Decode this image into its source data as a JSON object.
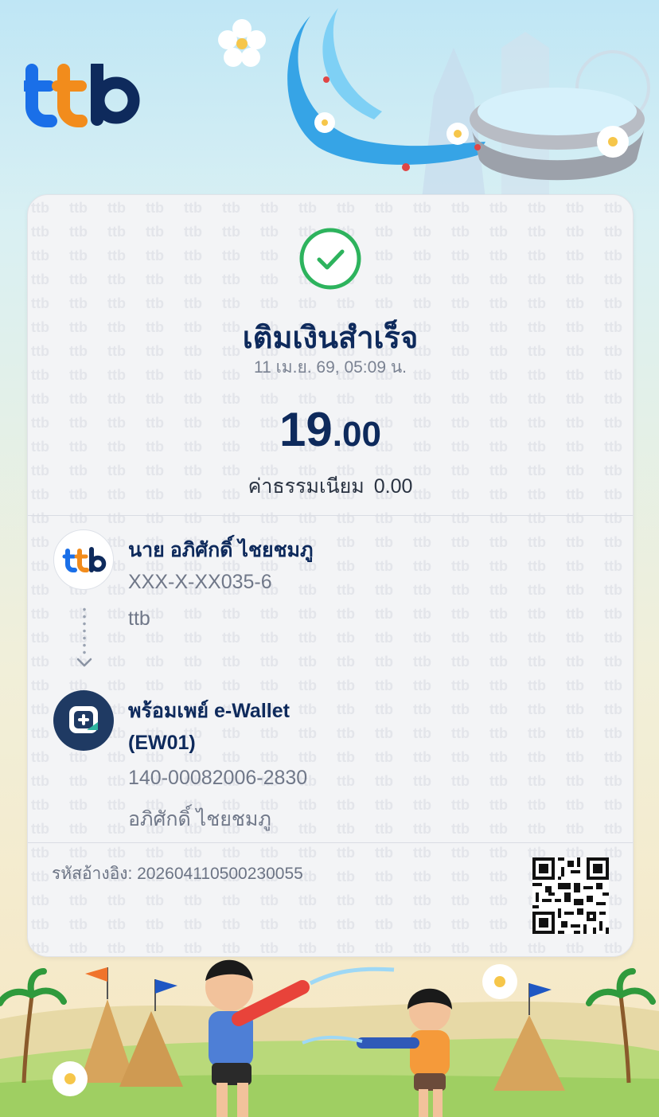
{
  "brand": {
    "name": "ttb",
    "colors": {
      "navy": "#0e2a5c",
      "blue": "#1a6fe8",
      "orange": "#f28c1c",
      "success": "#2db35d"
    }
  },
  "receipt": {
    "status_title": "เติมเงินสำเร็จ",
    "datetime": "11 เม.ย. 69, 05:09 น.",
    "amount_main": "19",
    "amount_decimal": ".00",
    "fee_label": "ค่าธรรมเนียม",
    "fee_value": "0.00"
  },
  "sender": {
    "name": "นาย อภิศักดิ์  ไชยชมภู",
    "account": "XXX-X-XX035-6",
    "bank": "ttb",
    "logo_text": "ttb"
  },
  "receiver": {
    "name": "พร้อมเพย์ e-Wallet",
    "code": "(EW01)",
    "account": "140-00082006-2830",
    "account_name": "อภิศักดิ์ ไชยชมภู",
    "icon": "promptpay-icon"
  },
  "reference": {
    "label": "รหัสอ้างอิง:",
    "value": "202604110500230055",
    "text": "รหัสอ้างอิง: 202604110500230055"
  },
  "decor": {
    "theme": "songkran-festival"
  }
}
